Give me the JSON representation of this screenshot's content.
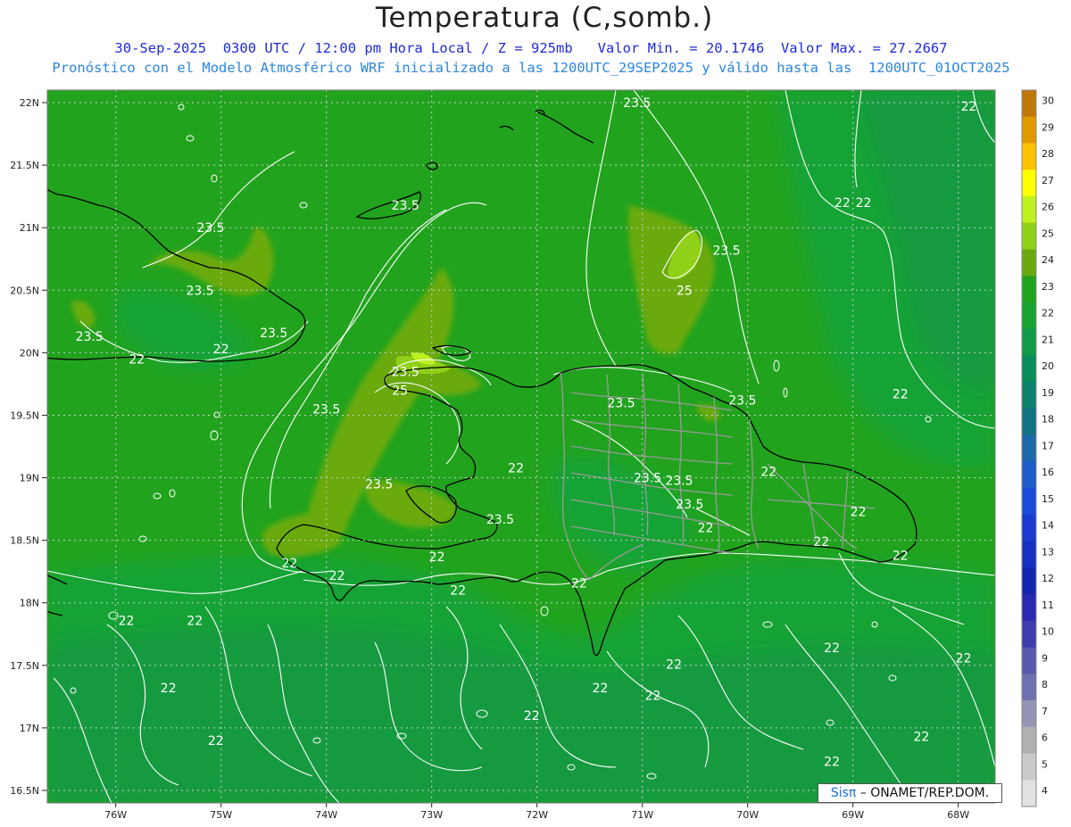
{
  "title": "Temperatura (C,somb.)",
  "subtitle_line1": "30-Sep-2025  0300 UTC / 12:00 pm Hora Local / Z = 925mb   Valor Min. = 20.1746  Valor Max. = 27.2667",
  "subtitle_line2": "Pronóstico con el Modelo Atmosférico WRF inicializado a las 1200UTC_29SEP2025 y válido hasta las  1200UTC_01OCT2025",
  "credit": {
    "logo": "Sisπ",
    "text": "– ONAMET/REP.DOM."
  },
  "lat_labels": [
    "22N",
    "21.5N",
    "21N",
    "20.5N",
    "20N",
    "19.5N",
    "19N",
    "18.5N",
    "18N",
    "17.5N",
    "17N",
    "16.5N"
  ],
  "lat_values": [
    22,
    21.5,
    21,
    20.5,
    20,
    19.5,
    19,
    18.5,
    18,
    17.5,
    17,
    16.5
  ],
  "lon_labels": [
    "76W",
    "75W",
    "74W",
    "73W",
    "72W",
    "71W",
    "70W",
    "69W",
    "68W"
  ],
  "lon_values": [
    -76,
    -75,
    -74,
    -73,
    -72,
    -71,
    -70,
    -69,
    -68
  ],
  "map_extent": {
    "lon_min": -76.65,
    "lon_max": -67.65,
    "lat_min": 16.4,
    "lat_max": 22.1
  },
  "colorbar": {
    "labels": [
      "30",
      "29",
      "28",
      "27",
      "26",
      "25",
      "24",
      "23",
      "22",
      "21",
      "20",
      "19",
      "18",
      "17",
      "16",
      "15",
      "14",
      "13",
      "12",
      "11",
      "10",
      "9",
      "8",
      "7",
      "6",
      "5",
      "4"
    ],
    "colors": [
      "#c07808",
      "#e09a00",
      "#ffc000",
      "#ffff00",
      "#bff020",
      "#90d018",
      "#6aaa10",
      "#22a31e",
      "#19a334",
      "#119a48",
      "#0b8c5c",
      "#0e806e",
      "#117282",
      "#1d67aa",
      "#1b5cc8",
      "#1a4bd8",
      "#1a3ad0",
      "#1730c0",
      "#1426b0",
      "#2a2ab0",
      "#3d3dad",
      "#5858ad",
      "#7070b0",
      "#9494b4",
      "#b0b0b0",
      "#cacaca",
      "#e2e2e2"
    ]
  },
  "contour_labels": [
    {
      "text": "23.5",
      "lon": -71.05,
      "lat": 22.0
    },
    {
      "text": "22",
      "lon": -67.9,
      "lat": 21.97
    },
    {
      "text": "23.5",
      "lon": -73.25,
      "lat": 21.18
    },
    {
      "text": "22",
      "lon": -69.1,
      "lat": 21.2
    },
    {
      "text": "22",
      "lon": -68.9,
      "lat": 21.2
    },
    {
      "text": "23.5",
      "lon": -75.1,
      "lat": 21.0
    },
    {
      "text": "23.5",
      "lon": -70.2,
      "lat": 20.82
    },
    {
      "text": "23.5",
      "lon": -75.2,
      "lat": 20.5
    },
    {
      "text": "25",
      "lon": -70.6,
      "lat": 20.5
    },
    {
      "text": "23.5",
      "lon": -74.5,
      "lat": 20.16
    },
    {
      "text": "23.5",
      "lon": -76.25,
      "lat": 20.13
    },
    {
      "text": "22",
      "lon": -75.0,
      "lat": 20.03
    },
    {
      "text": "22",
      "lon": -75.8,
      "lat": 19.95
    },
    {
      "text": "23.5",
      "lon": -73.25,
      "lat": 19.85
    },
    {
      "text": "25",
      "lon": -73.3,
      "lat": 19.7
    },
    {
      "text": "23.5",
      "lon": -71.2,
      "lat": 19.6
    },
    {
      "text": "23.5",
      "lon": -70.05,
      "lat": 19.62
    },
    {
      "text": "22",
      "lon": -68.55,
      "lat": 19.67
    },
    {
      "text": "23.5",
      "lon": -74.0,
      "lat": 19.55
    },
    {
      "text": "22",
      "lon": -72.2,
      "lat": 19.08
    },
    {
      "text": "23.5",
      "lon": -70.95,
      "lat": 19.0
    },
    {
      "text": "23.5",
      "lon": -70.65,
      "lat": 18.98
    },
    {
      "text": "22",
      "lon": -69.8,
      "lat": 19.05
    },
    {
      "text": "23.5",
      "lon": -73.5,
      "lat": 18.95
    },
    {
      "text": "23.5",
      "lon": -70.55,
      "lat": 18.79
    },
    {
      "text": "22",
      "lon": -68.95,
      "lat": 18.73
    },
    {
      "text": "23.5",
      "lon": -72.35,
      "lat": 18.67
    },
    {
      "text": "22",
      "lon": -70.4,
      "lat": 18.6
    },
    {
      "text": "22",
      "lon": -69.3,
      "lat": 18.49
    },
    {
      "text": "22",
      "lon": -68.55,
      "lat": 18.38
    },
    {
      "text": "22",
      "lon": -74.35,
      "lat": 18.32
    },
    {
      "text": "22",
      "lon": -72.95,
      "lat": 18.37
    },
    {
      "text": "22",
      "lon": -73.9,
      "lat": 18.22
    },
    {
      "text": "22",
      "lon": -71.6,
      "lat": 18.16
    },
    {
      "text": "22",
      "lon": -72.75,
      "lat": 18.1
    },
    {
      "text": "22",
      "lon": -75.25,
      "lat": 17.86
    },
    {
      "text": "22",
      "lon": -75.9,
      "lat": 17.86
    },
    {
      "text": "22",
      "lon": -69.2,
      "lat": 17.64
    },
    {
      "text": "22",
      "lon": -67.95,
      "lat": 17.56
    },
    {
      "text": "22",
      "lon": -70.7,
      "lat": 17.51
    },
    {
      "text": "22",
      "lon": -75.5,
      "lat": 17.32
    },
    {
      "text": "22",
      "lon": -71.4,
      "lat": 17.32
    },
    {
      "text": "22",
      "lon": -70.9,
      "lat": 17.26
    },
    {
      "text": "22",
      "lon": -72.05,
      "lat": 17.1
    },
    {
      "text": "22",
      "lon": -75.05,
      "lat": 16.9
    },
    {
      "text": "22",
      "lon": -68.35,
      "lat": 16.93
    },
    {
      "text": "22",
      "lon": -69.2,
      "lat": 16.73
    }
  ]
}
